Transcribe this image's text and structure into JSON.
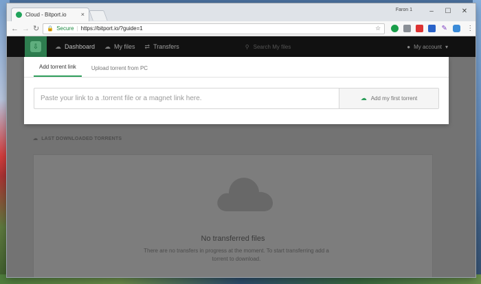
{
  "browser": {
    "tab_title": "Cloud - Bitport.io",
    "tab_close": "×",
    "user_name": "Faron 1",
    "url": "https://bitport.io/?guide=1",
    "secure_label": "Secure",
    "icons": {
      "back": "←",
      "forward": "→",
      "reload": "↻",
      "lock": "🔒",
      "star": "☆",
      "menu": "⋮",
      "minimize": "–",
      "maximize": "☐",
      "close": "✕"
    }
  },
  "site": {
    "nav": [
      {
        "label": "Dashboard",
        "icon": "☁"
      },
      {
        "label": "My files",
        "icon": "☁"
      },
      {
        "label": "Transfers",
        "icon": "⇄"
      }
    ],
    "search_placeholder": "Search My files",
    "account_label": "My account",
    "account_caret": "▾",
    "accent_color": "#2e9e5b"
  },
  "modal": {
    "tabs": [
      {
        "label": "Add torrent link",
        "active": true
      },
      {
        "label": "Upload torrent from PC",
        "active": false
      }
    ],
    "input_placeholder": "Paste your link to a .torrent file or a magnet link here.",
    "input_value": "",
    "add_button_label": "Add my first torrent"
  },
  "downloads": {
    "section_title": "LAST DOWNLOADED TORRENTS",
    "empty_title": "No transferred files",
    "empty_desc": "There are no transfers in progress at the moment. To start transferring add a torrent to download."
  }
}
